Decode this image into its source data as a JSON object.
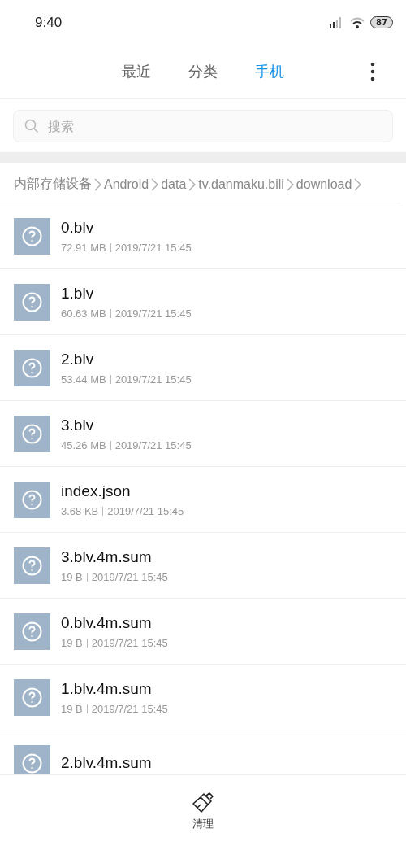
{
  "status_bar": {
    "time": "9:40",
    "battery": "87"
  },
  "tabs": [
    {
      "label": "最近",
      "selected": false
    },
    {
      "label": "分类",
      "selected": false
    },
    {
      "label": "手机",
      "selected": true
    }
  ],
  "search": {
    "placeholder": "搜索"
  },
  "breadcrumb": [
    "内部存储设备",
    "Android",
    "data",
    "tv.danmaku.bili",
    "download"
  ],
  "files": [
    {
      "name": "0.blv",
      "size": "72.91 MB",
      "date": "2019/7/21 15:45"
    },
    {
      "name": "1.blv",
      "size": "60.63 MB",
      "date": "2019/7/21 15:45"
    },
    {
      "name": "2.blv",
      "size": "53.44 MB",
      "date": "2019/7/21 15:45"
    },
    {
      "name": "3.blv",
      "size": "45.26 MB",
      "date": "2019/7/21 15:45"
    },
    {
      "name": "index.json",
      "size": "3.68 KB",
      "date": "2019/7/21 15:45"
    },
    {
      "name": "3.blv.4m.sum",
      "size": "19 B",
      "date": "2019/7/21 15:45"
    },
    {
      "name": "0.blv.4m.sum",
      "size": "19 B",
      "date": "2019/7/21 15:45"
    },
    {
      "name": "1.blv.4m.sum",
      "size": "19 B",
      "date": "2019/7/21 15:45"
    },
    {
      "name": "2.blv.4m.sum"
    }
  ],
  "bottom_action": {
    "label": "清理"
  }
}
